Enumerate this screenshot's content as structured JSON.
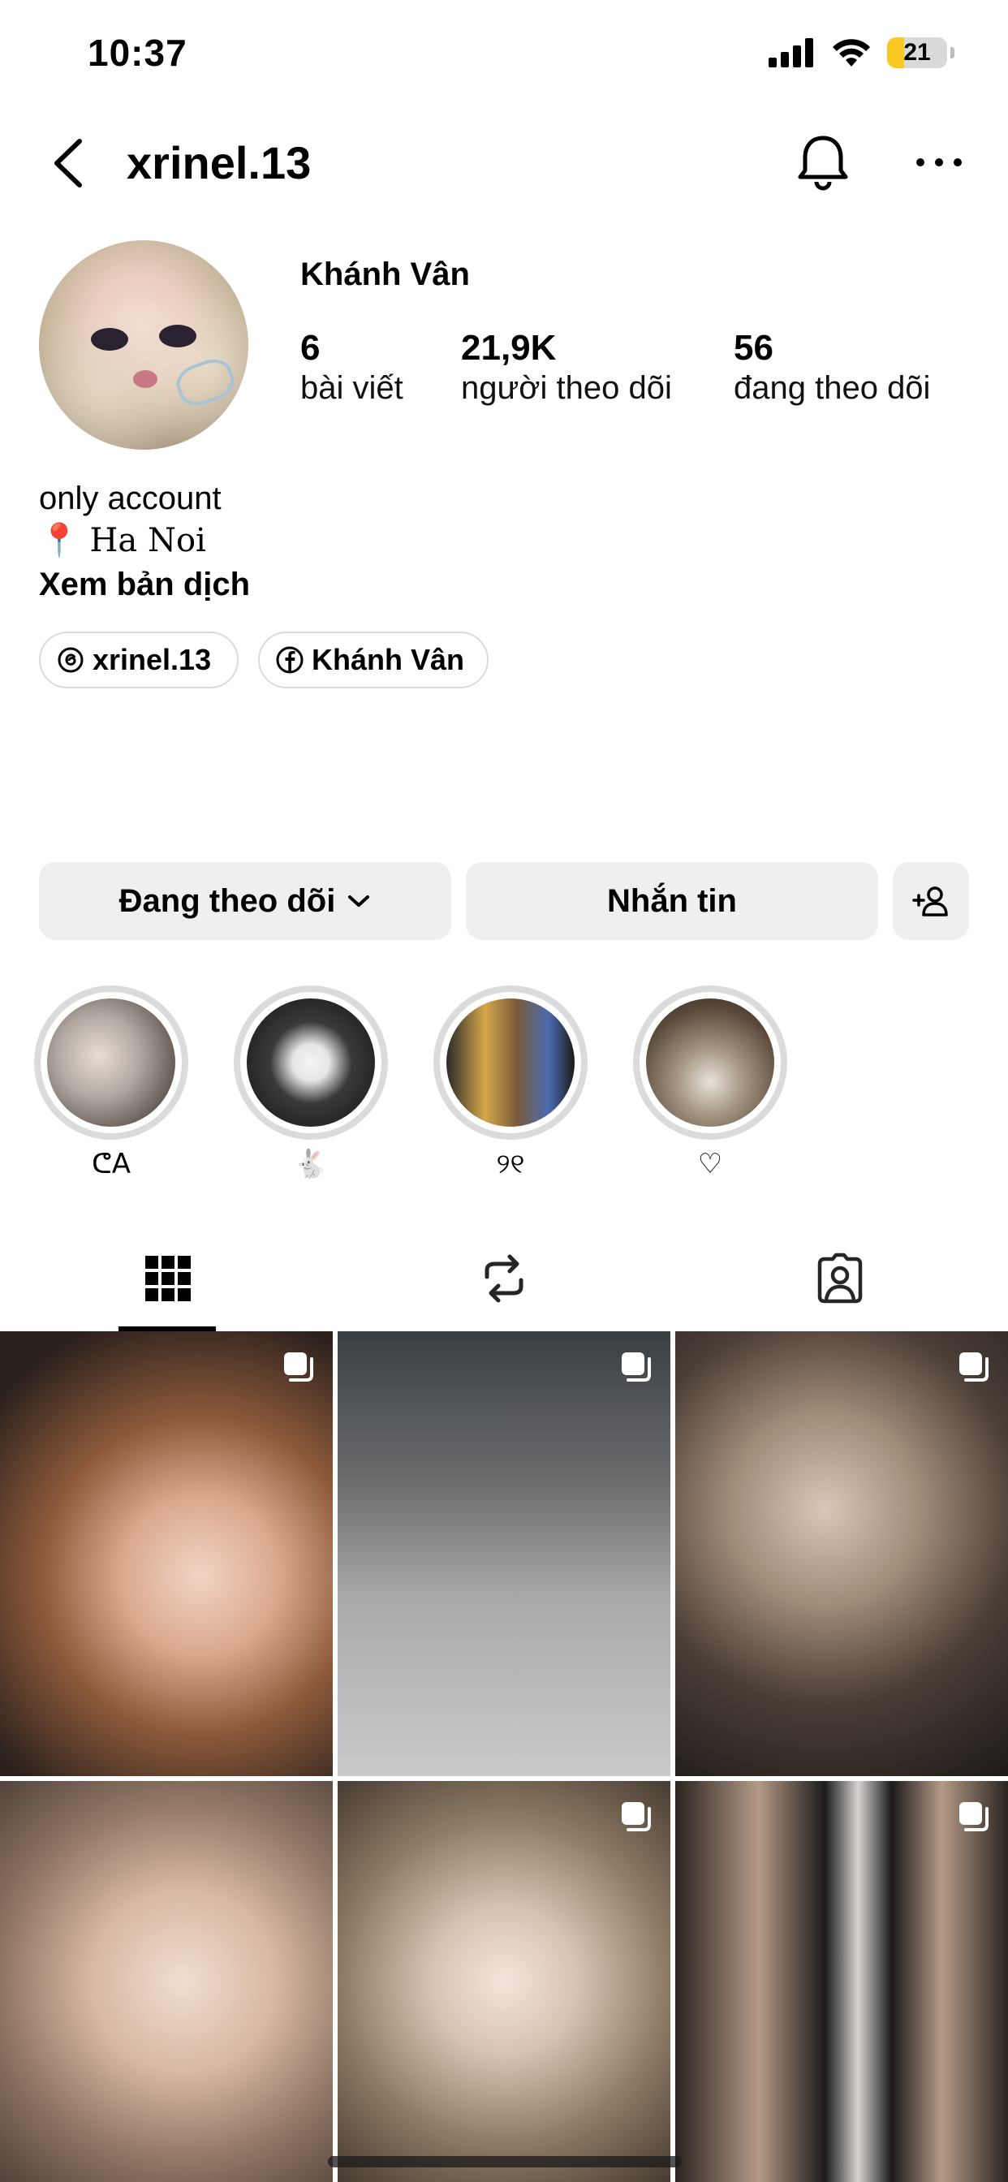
{
  "status_bar": {
    "time": "10:37",
    "battery": "21"
  },
  "nav": {
    "username": "xrinel.13"
  },
  "profile": {
    "display_name": "Khánh Vân",
    "stats": [
      {
        "value": "6",
        "label": "bài viết"
      },
      {
        "value": "21,9K",
        "label": "người theo dõi"
      },
      {
        "value": "56",
        "label": "đang theo dõi"
      }
    ],
    "bio": {
      "line1": "only account",
      "line2": "📍 Ha Noi",
      "translate": "Xem bản dịch"
    },
    "links": [
      {
        "label": "xrinel.13",
        "icon": "threads-icon"
      },
      {
        "label": "Khánh Vân",
        "icon": "facebook-icon"
      }
    ]
  },
  "actions": {
    "following_label": "Đang theo dõi",
    "message_label": "Nhắn tin",
    "add_user_icon": "add-person-icon"
  },
  "highlights": [
    {
      "label": "ᕦA"
    },
    {
      "label": "🐇"
    },
    {
      "label": "୨୧"
    },
    {
      "label": "♡"
    }
  ],
  "tabs": [
    {
      "name": "grid",
      "icon": "grid-icon",
      "active": true
    },
    {
      "name": "reposts",
      "icon": "repost-icon",
      "active": false
    },
    {
      "name": "tagged",
      "icon": "tagged-person-icon",
      "active": false
    }
  ],
  "colors": {
    "button_bg": "#efefef",
    "ring": "#dbdbdb",
    "battery": "#f7c922"
  }
}
